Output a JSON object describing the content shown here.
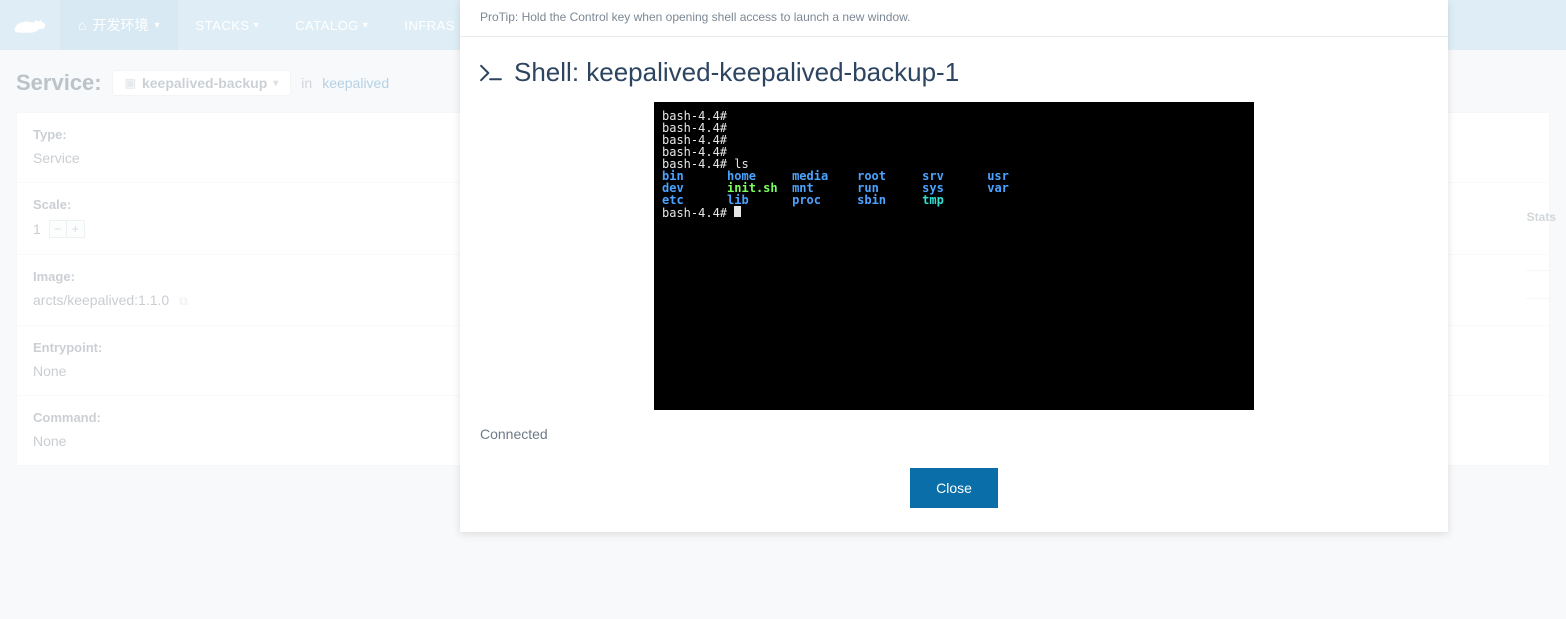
{
  "nav": {
    "env_label": "开发环境",
    "items": [
      "STACKS",
      "CATALOG",
      "INFRAS"
    ]
  },
  "crumb": {
    "label": "Service:",
    "service": "keepalived-backup",
    "in": "in",
    "stack": "keepalived"
  },
  "details": {
    "type_k": "Type:",
    "type_v": "Service",
    "scale_k": "Scale:",
    "scale_v": "1",
    "image_k": "Image:",
    "image_v": "arcts/keepalived:1.1.0",
    "entry_k": "Entrypoint:",
    "entry_v": "None",
    "cmd_k": "Command:",
    "cmd_v": "None"
  },
  "right": {
    "stats": "Stats"
  },
  "modal": {
    "protip": "ProTip: Hold the Control key when opening shell access to launch a new window.",
    "title": "Shell: keepalived-keepalived-backup-1",
    "status": "Connected",
    "close": "Close",
    "term": {
      "prompt": "bash-4.4#",
      "cmd_ls": "ls",
      "row1": {
        "c1": "bin",
        "c2": "home",
        "c3": "media",
        "c4": "root",
        "c5": "srv",
        "c6": "usr"
      },
      "row2": {
        "c1": "dev",
        "c2": "init.sh",
        "c3": "mnt",
        "c4": "run",
        "c5": "sys",
        "c6": "var"
      },
      "row3": {
        "c1": "etc",
        "c2": "lib",
        "c3": "proc",
        "c4": "sbin",
        "c5": "tmp"
      }
    }
  }
}
